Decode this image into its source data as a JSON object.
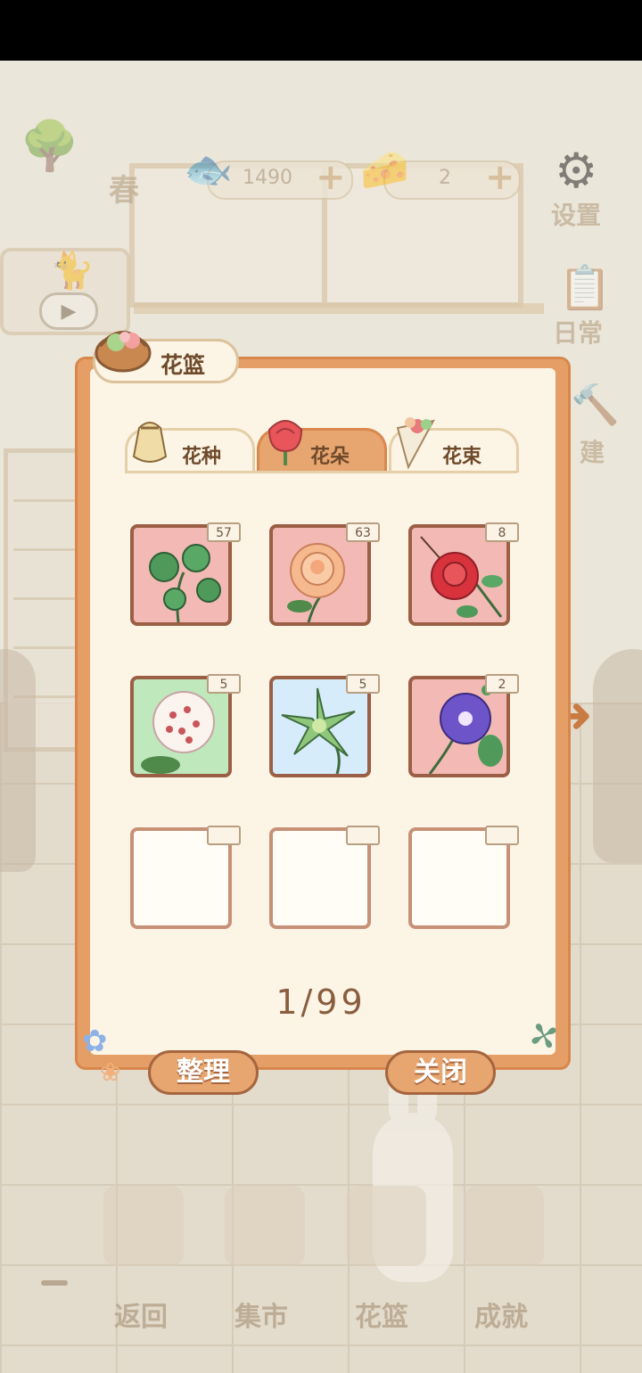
{
  "hud": {
    "season_label": "春",
    "fish_count": "1490",
    "cheese_count": "2",
    "settings_label": "设置",
    "daily_label": "日常",
    "build_label": "建"
  },
  "bottom_nav": {
    "back_label": "返回",
    "market_label": "集市",
    "basket_label": "花篮",
    "achievements_label": "成就"
  },
  "dialog": {
    "title": "花篮",
    "tabs": [
      {
        "label": "花种",
        "active": false
      },
      {
        "label": "花朵",
        "active": true
      },
      {
        "label": "花束",
        "active": false
      }
    ],
    "slots": [
      {
        "count": "57",
        "bg": "pink",
        "flower": "pennywort"
      },
      {
        "count": "63",
        "bg": "pink",
        "flower": "peach-rose"
      },
      {
        "count": "8",
        "bg": "pink",
        "flower": "red-rose"
      },
      {
        "count": "5",
        "bg": "green",
        "flower": "hoya"
      },
      {
        "count": "5",
        "bg": "blue",
        "flower": "green-lily"
      },
      {
        "count": "2",
        "bg": "pink",
        "flower": "morning-glory"
      },
      {
        "count": "",
        "bg": "empty",
        "flower": ""
      },
      {
        "count": "",
        "bg": "empty",
        "flower": ""
      },
      {
        "count": "",
        "bg": "empty",
        "flower": ""
      }
    ],
    "page": "1/99",
    "sort_label": "整理",
    "close_label": "关闭"
  }
}
